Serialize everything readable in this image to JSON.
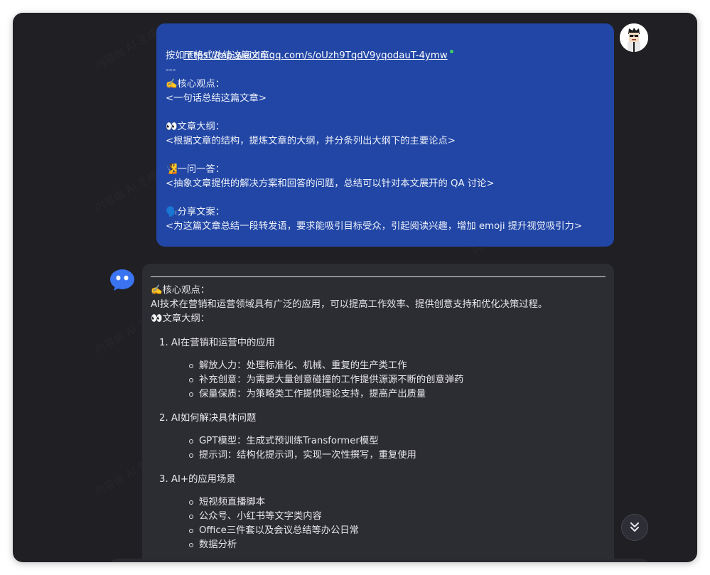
{
  "user_message": {
    "lines": [
      "按如下格式总结这篇文章：",
      "---",
      "✍️核心观点：",
      "<一句话总结这篇文章>",
      "",
      "👀文章大纲：",
      "<根据文章的结构，提炼文章的大纲，并分条列出大纲下的主要论点>",
      "",
      "🧏一问一答：",
      "<抽象文章提供的解决方案和回答的问题，总结可以针对本文展开的 QA 讨论>",
      "",
      "🗣️分享文案：",
      "<为这篇文章总结一段转发语，要求能吸引目标受众，引起阅读兴趣，增加 emoji 提升视觉吸引力>"
    ],
    "link": "https://mp.weixin.qq.com/s/oUzh9TqdV9yqodauT-4ymw"
  },
  "bot_message": {
    "core_label": "✍️核心观点：",
    "core_text": "AI技术在营销和运营领域具有广泛的应用，可以提高工作效率、提供创意支持和优化决策过程。",
    "outline_label": "👀文章大纲：",
    "sections": [
      {
        "title": "1. AI在营销和运营中的应用",
        "items": [
          "解放人力：处理标准化、机械、重复的生产类工作",
          "补充创意：为需要大量创意碰撞的工作提供源源不断的创意弹药",
          "保量保质：为策略类工作提供理论支持，提高产出质量"
        ]
      },
      {
        "title": "2. AI如何解决具体问题",
        "items": [
          "GPT模型：生成式预训练Transformer模型",
          "提示词：结构化提示词，实现一次性撰写，重复使用"
        ]
      },
      {
        "title": "3. AI+的应用场景",
        "items": [
          "短视频直播脚本",
          "公众号、小红书等文字类内容",
          "Office三件套以及会议总结等办公日常",
          "数据分析"
        ]
      }
    ]
  },
  "watermark_text": "内容由 AI 生成",
  "icons": {
    "user_avatar": "user-avatar-icon",
    "bot_avatar": "robot-avatar-icon",
    "scroll_down": "double-chevron-down-icon"
  },
  "colors": {
    "background": "#1f1f24",
    "user_bubble": "#2146a5",
    "bot_bubble": "#2c2c33"
  }
}
